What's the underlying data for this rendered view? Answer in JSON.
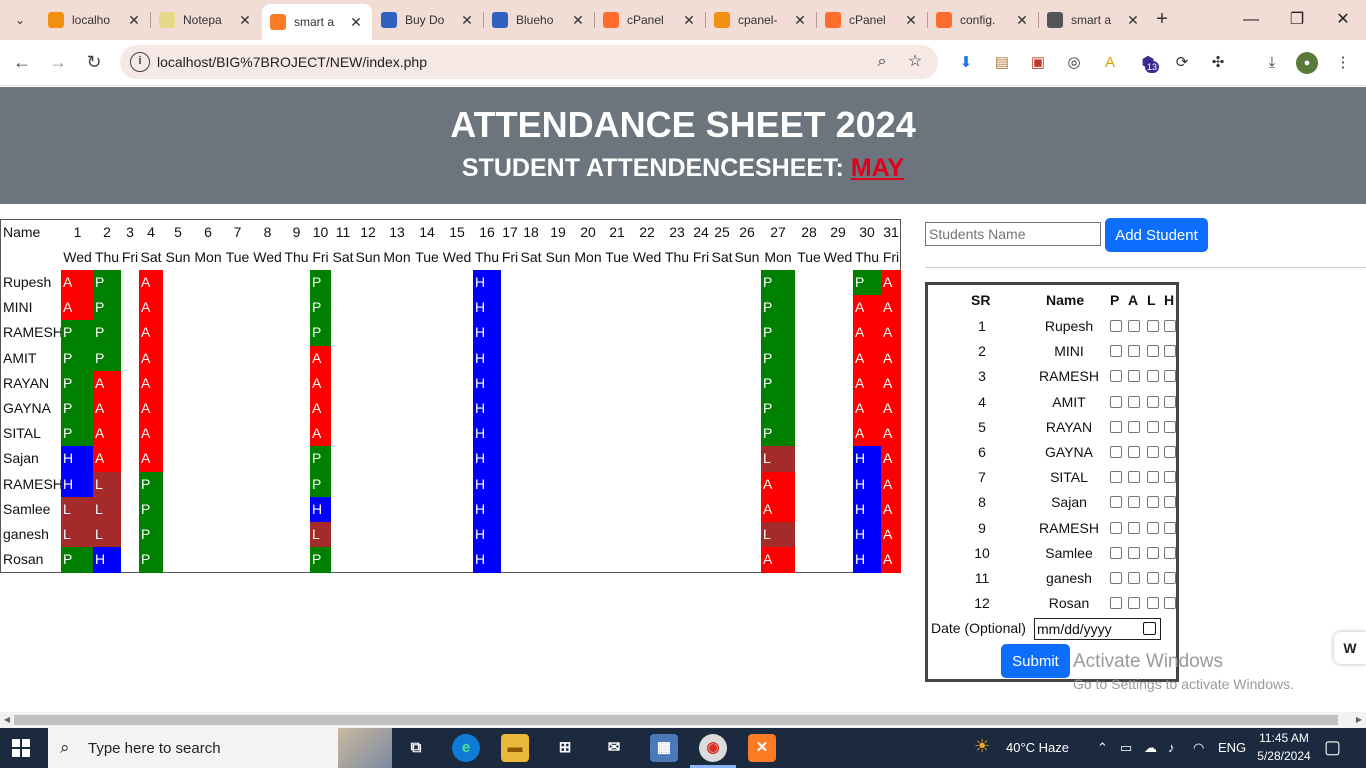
{
  "browser": {
    "tabs": [
      {
        "title": "localho",
        "icon": "phpmyadmin-icon",
        "color": "#f29111"
      },
      {
        "title": "Notepa",
        "icon": "notepad-icon",
        "color": "#e8d88a"
      },
      {
        "title": "smart a",
        "icon": "xampp-icon",
        "color": "#fb7a24",
        "active": true
      },
      {
        "title": "Buy Do",
        "icon": "grid-icon",
        "color": "#3060c0"
      },
      {
        "title": "Blueho",
        "icon": "grid-icon",
        "color": "#3060c0"
      },
      {
        "title": "cPanel",
        "icon": "cpanel-icon",
        "color": "#ff6c2c"
      },
      {
        "title": "cpanel-",
        "icon": "phpmyadmin-icon",
        "color": "#f29111"
      },
      {
        "title": "cPanel",
        "icon": "cpanel-icon",
        "color": "#ff6c2c"
      },
      {
        "title": "config.",
        "icon": "cpanel-icon",
        "color": "#ff6c2c"
      },
      {
        "title": "smart a",
        "icon": "globe-icon",
        "color": "#555555"
      }
    ],
    "url": "localhost/BIG%7BROJECT/NEW/index.php",
    "ext_badge": "13"
  },
  "page": {
    "title": "ATTENDANCE SHEET 2024",
    "subtitle": "STUDENT ATTENDENCESHEET:",
    "month": "MAY"
  },
  "sheet": {
    "name_header": "Name",
    "days": [
      "1",
      "2",
      "3",
      "4",
      "5",
      "6",
      "7",
      "8",
      "9",
      "10",
      "11",
      "12",
      "13",
      "14",
      "15",
      "16",
      "17",
      "18",
      "19",
      "20",
      "21",
      "22",
      "23",
      "24",
      "25",
      "26",
      "27",
      "28",
      "29",
      "30",
      "31"
    ],
    "weekdays": [
      "Wed",
      "Thu",
      "Fri",
      "Sat",
      "Sun",
      "Mon",
      "Tue",
      "Wed",
      "Thu",
      "Fri",
      "Sat",
      "Sun",
      "Mon",
      "Tue",
      "Wed",
      "Thu",
      "Fri",
      "Sat",
      "Sun",
      "Mon",
      "Tue",
      "Wed",
      "Thu",
      "Fri",
      "Sat",
      "Sun",
      "Mon",
      "Tue",
      "Wed",
      "Thu",
      "Fri"
    ],
    "students": [
      {
        "name": "Rupesh",
        "marks": {
          "1": "A",
          "2": "P",
          "4": "A",
          "10": "P",
          "16": "H",
          "27": "P",
          "30": "P",
          "31": "A"
        }
      },
      {
        "name": "MINI",
        "marks": {
          "1": "A",
          "2": "P",
          "4": "A",
          "10": "P",
          "16": "H",
          "27": "P",
          "30": "A",
          "31": "A"
        }
      },
      {
        "name": "RAMESH",
        "marks": {
          "1": "P",
          "2": "P",
          "4": "A",
          "10": "P",
          "16": "H",
          "27": "P",
          "30": "A",
          "31": "A"
        }
      },
      {
        "name": "AMIT",
        "marks": {
          "1": "P",
          "2": "P",
          "4": "A",
          "10": "A",
          "16": "H",
          "27": "P",
          "30": "A",
          "31": "A"
        }
      },
      {
        "name": "RAYAN",
        "marks": {
          "1": "P",
          "2": "A",
          "4": "A",
          "10": "A",
          "16": "H",
          "27": "P",
          "30": "A",
          "31": "A"
        }
      },
      {
        "name": "GAYNA",
        "marks": {
          "1": "P",
          "2": "A",
          "4": "A",
          "10": "A",
          "16": "H",
          "27": "P",
          "30": "A",
          "31": "A"
        }
      },
      {
        "name": "SITAL",
        "marks": {
          "1": "P",
          "2": "A",
          "4": "A",
          "10": "A",
          "16": "H",
          "27": "P",
          "30": "A",
          "31": "A"
        }
      },
      {
        "name": "Sajan",
        "marks": {
          "1": "H",
          "2": "A",
          "4": "A",
          "10": "P",
          "16": "H",
          "27": "L",
          "30": "H",
          "31": "A"
        }
      },
      {
        "name": "RAMESH",
        "marks": {
          "1": "H",
          "2": "L",
          "4": "P",
          "10": "P",
          "16": "H",
          "27": "A",
          "30": "H",
          "31": "A"
        }
      },
      {
        "name": "Samlee",
        "marks": {
          "1": "L",
          "2": "L",
          "4": "P",
          "10": "H",
          "16": "H",
          "27": "A",
          "30": "H",
          "31": "A"
        }
      },
      {
        "name": "ganesh",
        "marks": {
          "1": "L",
          "2": "L",
          "4": "P",
          "10": "L",
          "16": "H",
          "27": "L",
          "30": "H",
          "31": "A"
        }
      },
      {
        "name": "Rosan",
        "marks": {
          "1": "P",
          "2": "H",
          "4": "P",
          "10": "P",
          "16": "H",
          "27": "A",
          "30": "H",
          "31": "A"
        }
      }
    ],
    "colors": {
      "P": "#008000",
      "A": "#ff0000",
      "H": "#0000ff",
      "L": "#a52a2a"
    }
  },
  "form": {
    "name_placeholder": "Students Name",
    "add_label": "Add Student",
    "headers": {
      "sr": "SR",
      "name": "Name",
      "p": "P",
      "a": "A",
      "l": "L",
      "h": "H"
    },
    "date_label": "Date (Optional)",
    "date_placeholder": "mm/dd/yyyy",
    "submit_label": "Submit"
  },
  "overlay": {
    "line1": "Activate Windows",
    "line2": "Go to Settings to activate Windows."
  },
  "taskbar": {
    "search_placeholder": "Type here to search",
    "weather": "40°C  Haze",
    "lang": "ENG",
    "time": "11:45 AM",
    "date": "5/28/2024"
  }
}
